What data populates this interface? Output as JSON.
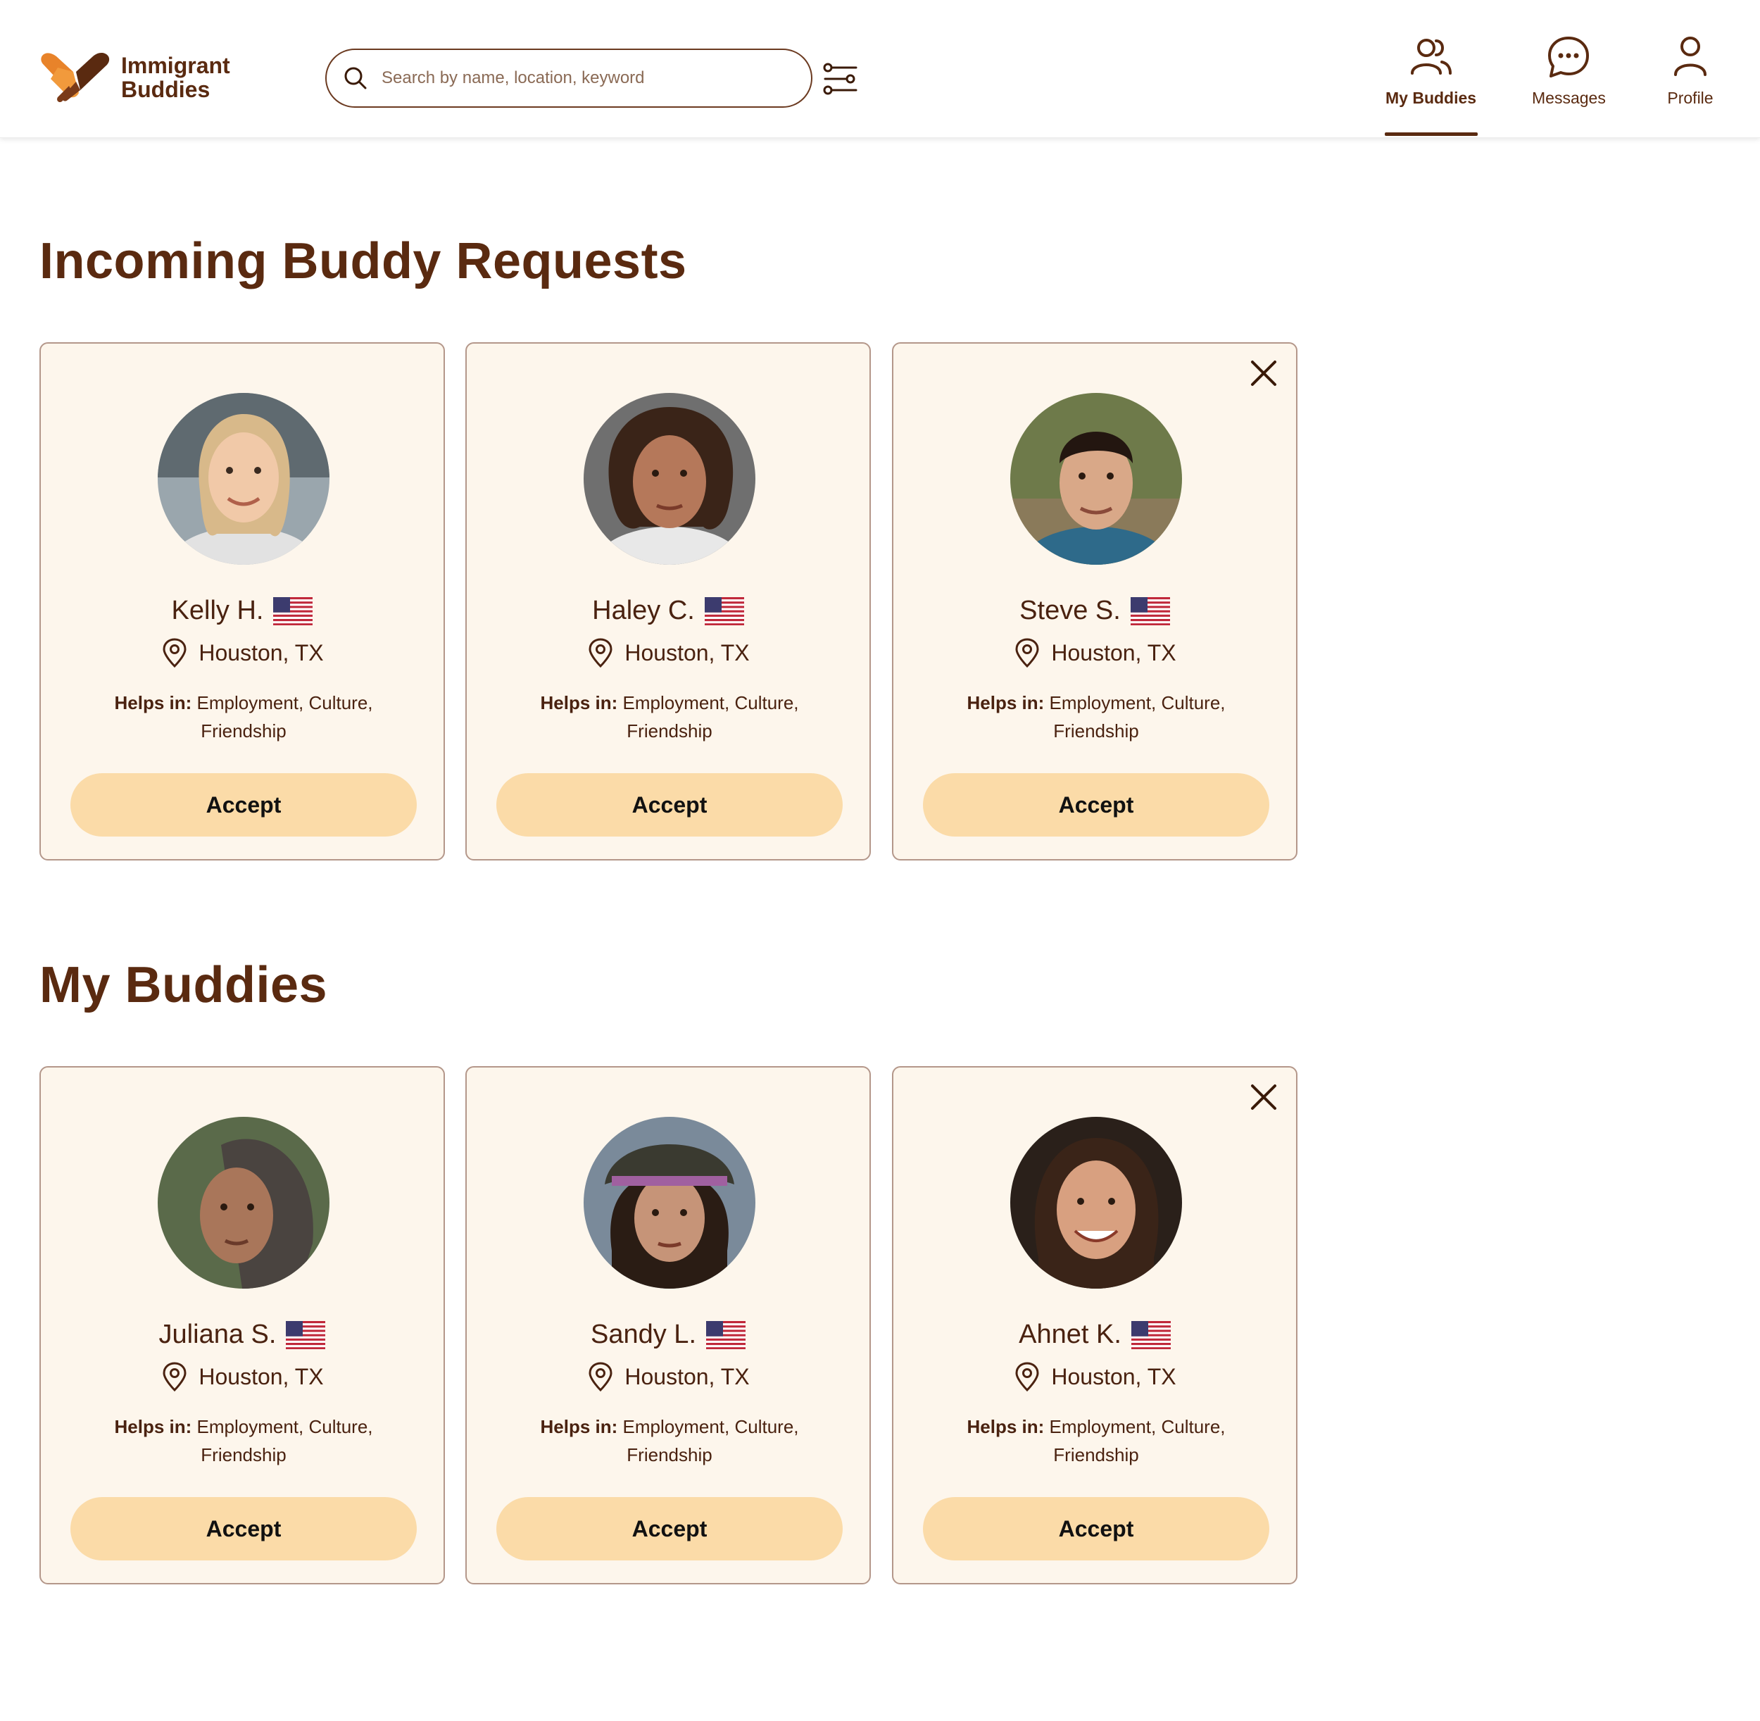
{
  "app": {
    "logo_line1": "Immigrant",
    "logo_line2": "Buddies",
    "brand_colors": {
      "primary": "#5a2a10",
      "accent": "#e8832a",
      "button": "#fbdba8",
      "card": "#fdf6ec"
    }
  },
  "search": {
    "placeholder": "Search by name, location, keyword",
    "value": ""
  },
  "nav": {
    "my_buddies": "My Buddies",
    "messages": "Messages",
    "profile": "Profile",
    "active": "My Buddies"
  },
  "sections": {
    "incoming": {
      "title": "Incoming Buddy Requests",
      "cards": [
        {
          "name": "Kelly H.",
          "location": "Houston, TX",
          "helps_label": "Helps in:",
          "helps_line1": "Employment, Culture,",
          "helps_line2": "Friendship",
          "action": "Accept",
          "flag": "us-flag-icon"
        },
        {
          "name": "Haley C.",
          "location": "Houston, TX",
          "helps_label": "Helps in:",
          "helps_line1": "Employment, Culture,",
          "helps_line2": "Friendship",
          "action": "Accept",
          "flag": "us-flag-icon"
        },
        {
          "name": "Steve S.",
          "location": "Houston, TX",
          "helps_label": "Helps in:",
          "helps_line1": "Employment, Culture,",
          "helps_line2": "Friendship",
          "action": "Accept",
          "flag": "us-flag-icon"
        }
      ]
    },
    "buddies": {
      "title": "My Buddies",
      "cards": [
        {
          "name": "Juliana S.",
          "location": "Houston, TX",
          "helps_label": "Helps in:",
          "helps_line1": "Employment, Culture,",
          "helps_line2": "Friendship",
          "action": "Accept",
          "flag": "us-flag-icon"
        },
        {
          "name": "Sandy L.",
          "location": "Houston, TX",
          "helps_label": "Helps in:",
          "helps_line1": "Employment, Culture,",
          "helps_line2": "Friendship",
          "action": "Accept",
          "flag": "us-flag-icon"
        },
        {
          "name": "Ahnet K.",
          "location": "Houston, TX",
          "helps_label": "Helps in:",
          "helps_line1": "Employment, Culture,",
          "helps_line2": "Friendship",
          "action": "Accept",
          "flag": "us-flag-icon"
        }
      ]
    }
  }
}
